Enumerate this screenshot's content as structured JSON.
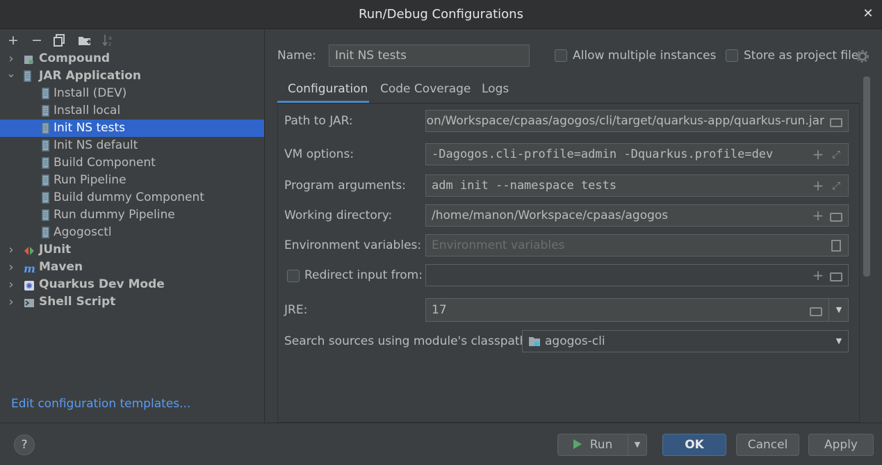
{
  "window": {
    "title": "Run/Debug Configurations",
    "close_glyph": "✕"
  },
  "toolbar": {
    "add": "+",
    "remove": "−",
    "copy_icon": "copy-icon",
    "folder_icon": "new-folder-icon",
    "sort_icon": "sort-icon"
  },
  "tree": [
    {
      "label": "Compound",
      "kind": "group",
      "expanded": false,
      "icon": "compound-icon"
    },
    {
      "label": "JAR Application",
      "kind": "group",
      "expanded": true,
      "icon": "jar-icon"
    },
    {
      "label": "Install (DEV)",
      "kind": "item",
      "icon": "jar-icon"
    },
    {
      "label": "Install local",
      "kind": "item",
      "icon": "jar-icon"
    },
    {
      "label": "Init NS tests",
      "kind": "item",
      "icon": "jar-icon",
      "selected": true
    },
    {
      "label": "Init NS default",
      "kind": "item",
      "icon": "jar-icon"
    },
    {
      "label": "Build Component",
      "kind": "item",
      "icon": "jar-icon"
    },
    {
      "label": "Run Pipeline",
      "kind": "item",
      "icon": "jar-icon"
    },
    {
      "label": "Build dummy Component",
      "kind": "item",
      "icon": "jar-icon"
    },
    {
      "label": "Run dummy Pipeline",
      "kind": "item",
      "icon": "jar-icon"
    },
    {
      "label": "Agogosctl",
      "kind": "item",
      "icon": "jar-icon"
    },
    {
      "label": "JUnit",
      "kind": "group",
      "expanded": false,
      "icon": "junit-icon"
    },
    {
      "label": "Maven",
      "kind": "group",
      "expanded": false,
      "icon": "maven-icon"
    },
    {
      "label": "Quarkus Dev Mode",
      "kind": "group",
      "expanded": false,
      "icon": "quarkus-icon"
    },
    {
      "label": "Shell Script",
      "kind": "group",
      "expanded": false,
      "icon": "shell-icon"
    }
  ],
  "left_footer": {
    "edit_templates": "Edit configuration templates..."
  },
  "header": {
    "name_label": "Name:",
    "name_value": "Init NS tests",
    "allow_multiple_label": "Allow multiple instances",
    "allow_multiple_checked": false,
    "store_project_label": "Store as project file",
    "store_project_checked": false
  },
  "tabs": [
    {
      "label": "Configuration",
      "active": true
    },
    {
      "label": "Code Coverage",
      "active": false
    },
    {
      "label": "Logs",
      "active": false
    }
  ],
  "form": {
    "path_jar_label": "Path to JAR:",
    "path_jar_value": "nanon/Workspace/cpaas/agogos/cli/target/quarkus-app/quarkus-run.jar",
    "vm_options_label": "VM options:",
    "vm_options_value": "-Dagogos.cli-profile=admin -Dquarkus.profile=dev",
    "program_args_label": "Program arguments:",
    "program_args_value": "adm init --namespace tests",
    "working_dir_label": "Working directory:",
    "working_dir_value": "/home/manon/Workspace/cpaas/agogos",
    "env_vars_label": "Environment variables:",
    "env_vars_placeholder": "Environment variables",
    "redirect_label": "Redirect input from:",
    "redirect_checked": false,
    "redirect_value": "",
    "jre_label": "JRE:",
    "jre_value": "17",
    "classpath_label": "Search sources using module's classpath:",
    "classpath_value": "agogos-cli"
  },
  "footer": {
    "help": "?",
    "run": "Run",
    "ok": "OK",
    "cancel": "Cancel",
    "apply": "Apply"
  },
  "colors": {
    "background": "#3c3f41",
    "selection": "#2f65ca",
    "link": "#589df6",
    "ok_button": "#365880",
    "run_icon": "#59a869"
  }
}
